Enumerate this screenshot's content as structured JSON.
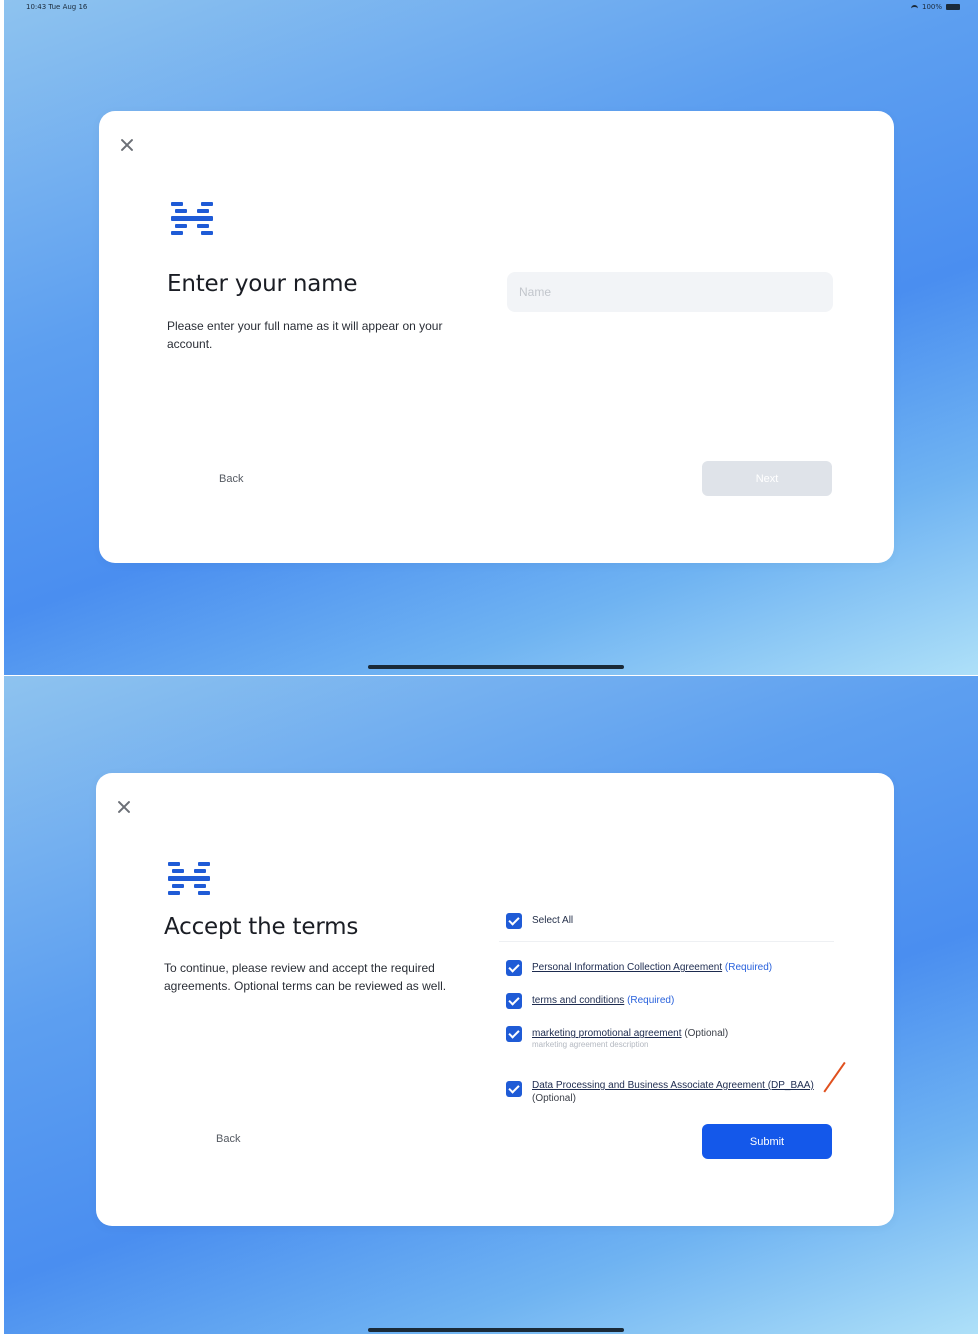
{
  "status_bar": {
    "time": "10:43 Tue Aug 16",
    "battery": "100%"
  },
  "screen1": {
    "title": "Enter your name",
    "description": "Please enter your full name as it will appear on your account.",
    "name_placeholder": "Name",
    "back_label": "Back",
    "next_label": "Next"
  },
  "screen2": {
    "title": "Accept the terms",
    "description": "To continue, please review and accept the required agreements. Optional terms can be reviewed as well.",
    "select_all_label": "Select All",
    "terms": [
      {
        "label": "Personal Information Collection Agreement",
        "tag": "(Required)"
      },
      {
        "label": "terms and conditions",
        "tag": "(Required)"
      },
      {
        "label": "marketing promotional agreement",
        "tag": "(Optional)",
        "subtext": "marketing agreement description"
      },
      {
        "label": "Data Processing and Business Associate Agreement (DP_BAA)",
        "tag": "(Optional)"
      }
    ],
    "back_label": "Back",
    "submit_label": "Submit"
  },
  "colors": {
    "accent": "#1458ea",
    "checkbox": "#1f5bd6",
    "logo": "#1f5bd6"
  }
}
